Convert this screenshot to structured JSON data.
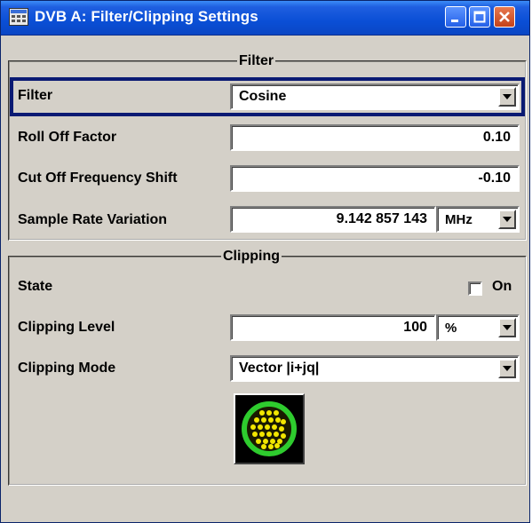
{
  "window": {
    "title": "DVB A: Filter/Clipping Settings"
  },
  "filter_group": {
    "title": "Filter",
    "filter": {
      "label": "Filter",
      "value": "Cosine"
    },
    "roll_off": {
      "label": "Roll Off Factor",
      "value": "0.10"
    },
    "cut_off": {
      "label": "Cut Off Frequency Shift",
      "value": "-0.10"
    },
    "sample_rate": {
      "label": "Sample Rate Variation",
      "value": "9.142 857 143",
      "unit": "MHz"
    }
  },
  "clipping_group": {
    "title": "Clipping",
    "state": {
      "label": "State",
      "checkbox_label": "On",
      "checked": false
    },
    "level": {
      "label": "Clipping Level",
      "value": "100",
      "unit": "%"
    },
    "mode": {
      "label": "Clipping Mode",
      "value": "Vector |i+jq|"
    }
  },
  "icons": {
    "app": "window-icon",
    "minimize": "minimize-icon",
    "maximize": "maximize-icon",
    "close": "close-icon",
    "dropdown": "chevron-down-icon",
    "clipping_graphic": "vector-clipping-icon"
  },
  "colors": {
    "titlebar": "#0a4fd6",
    "close_button": "#c4421a",
    "focus_ring": "#0a1a73",
    "panel_bg": "#d4d0c8",
    "scope_ring": "#2ecc2e",
    "scope_dots": "#f2e600"
  }
}
